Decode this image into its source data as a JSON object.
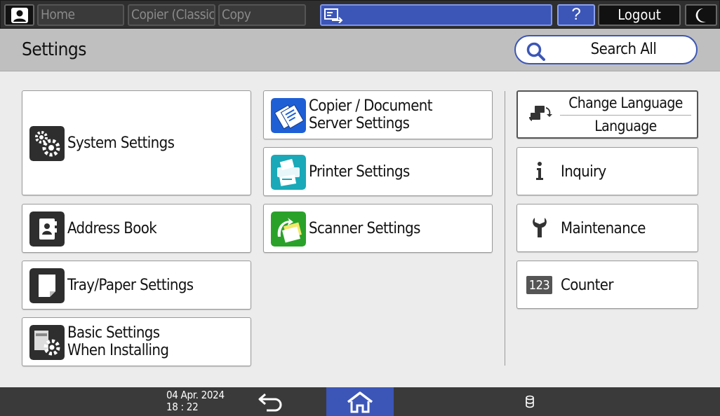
{
  "topbar": {
    "tabs": [
      "Home",
      "Copier (Classic)",
      "Copy"
    ],
    "help_label": "?",
    "logout_label": "Logout"
  },
  "header": {
    "title": "Settings",
    "search_label": "Search All"
  },
  "left_items": [
    {
      "label": "System Settings",
      "icon": "system-settings-icon"
    },
    {
      "label": "Address Book",
      "icon": "address-book-icon"
    },
    {
      "label": "Tray/Paper Settings",
      "icon": "tray-paper-icon"
    },
    {
      "label_line1": "Basic Settings",
      "label_line2": "When Installing",
      "icon": "basic-settings-icon"
    }
  ],
  "middle_items": [
    {
      "label_line1": "Copier / Document",
      "label_line2": "Server Settings",
      "icon": "copier-document-icon"
    },
    {
      "label": "Printer Settings",
      "icon": "printer-icon"
    },
    {
      "label": "Scanner Settings",
      "icon": "scanner-icon"
    }
  ],
  "right_items": {
    "language": {
      "title": "Change Language",
      "value": "Language"
    },
    "inquiry": "Inquiry",
    "maintenance": "Maintenance",
    "counter": "Counter",
    "counter_icon_text": "123"
  },
  "bottombar": {
    "date": "04 Apr. 2024",
    "time": "18 : 22"
  },
  "colors": {
    "accent_blue": "#3c56b7",
    "topbar": "#2f2f2f",
    "header": "#bfbfbf",
    "background": "#ececec"
  }
}
